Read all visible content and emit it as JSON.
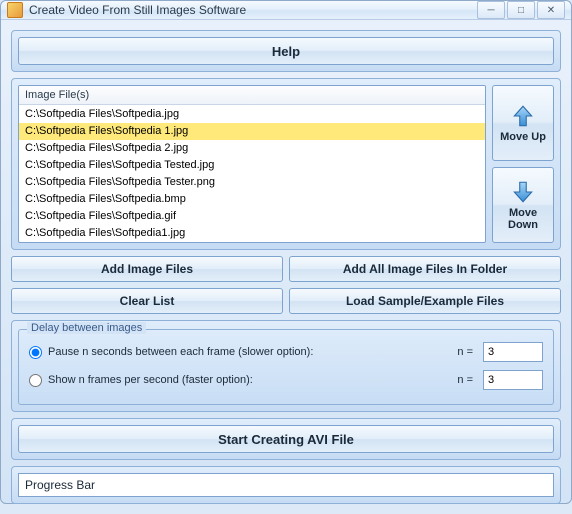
{
  "window": {
    "title": "Create Video From Still Images Software"
  },
  "help": {
    "label": "Help"
  },
  "files": {
    "header": "Image File(s)",
    "list": [
      "C:\\Softpedia Files\\Softpedia.jpg",
      "C:\\Softpedia Files\\Softpedia 1.jpg",
      "C:\\Softpedia Files\\Softpedia 2.jpg",
      "C:\\Softpedia Files\\Softpedia Tested.jpg",
      "C:\\Softpedia Files\\Softpedia Tester.png",
      "C:\\Softpedia Files\\Softpedia.bmp",
      "C:\\Softpedia Files\\Softpedia.gif",
      "C:\\Softpedia Files\\Softpedia1.jpg"
    ],
    "selected_index": 1
  },
  "move": {
    "up_label": "Move Up",
    "down_label": "Move Down"
  },
  "buttons": {
    "add_files": "Add Image Files",
    "add_folder": "Add All Image Files In Folder",
    "clear": "Clear List",
    "load_sample": "Load Sample/Example Files",
    "start": "Start Creating AVI File"
  },
  "delay": {
    "legend": "Delay between images",
    "pause_label": "Pause n seconds between each frame (slower option):",
    "show_label": "Show n frames per second (faster option):",
    "n_label": "n =",
    "pause_value": "3",
    "show_value": "3",
    "selected": "pause"
  },
  "progress": {
    "label": "Progress Bar"
  },
  "colors": {
    "accent": "#3a8fd8",
    "arrow_fill_top": "#a9d6f7",
    "arrow_fill_bot": "#3a8fd8",
    "arrow_stroke": "#2a6aa8"
  }
}
